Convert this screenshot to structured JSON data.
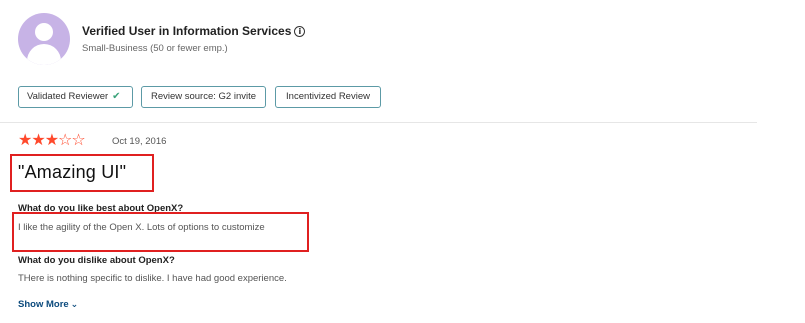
{
  "reviewer": {
    "name": "Verified User in Information Services",
    "info_icon": "ⓘ",
    "segment": "Small-Business (50 or fewer emp.)"
  },
  "badges": [
    {
      "label": "Validated Reviewer",
      "icon": "check-icon"
    },
    {
      "label": "Review source: G2 invite"
    },
    {
      "label": "Incentivized Review"
    }
  ],
  "review": {
    "rating": 3,
    "rating_max": 5,
    "star_color": "#ff492c",
    "date": "Oct 19, 2016",
    "title": "\"Amazing UI\"",
    "questions": [
      {
        "q": "What do you like best about OpenX?",
        "a": "I like the agility of the Open X. Lots of options to customize"
      },
      {
        "q": "What do you dislike about OpenX?",
        "a": "THere is nothing specific to dislike. I have had good experience."
      }
    ],
    "show_more": "Show More"
  },
  "highlight_color": "#e02020"
}
